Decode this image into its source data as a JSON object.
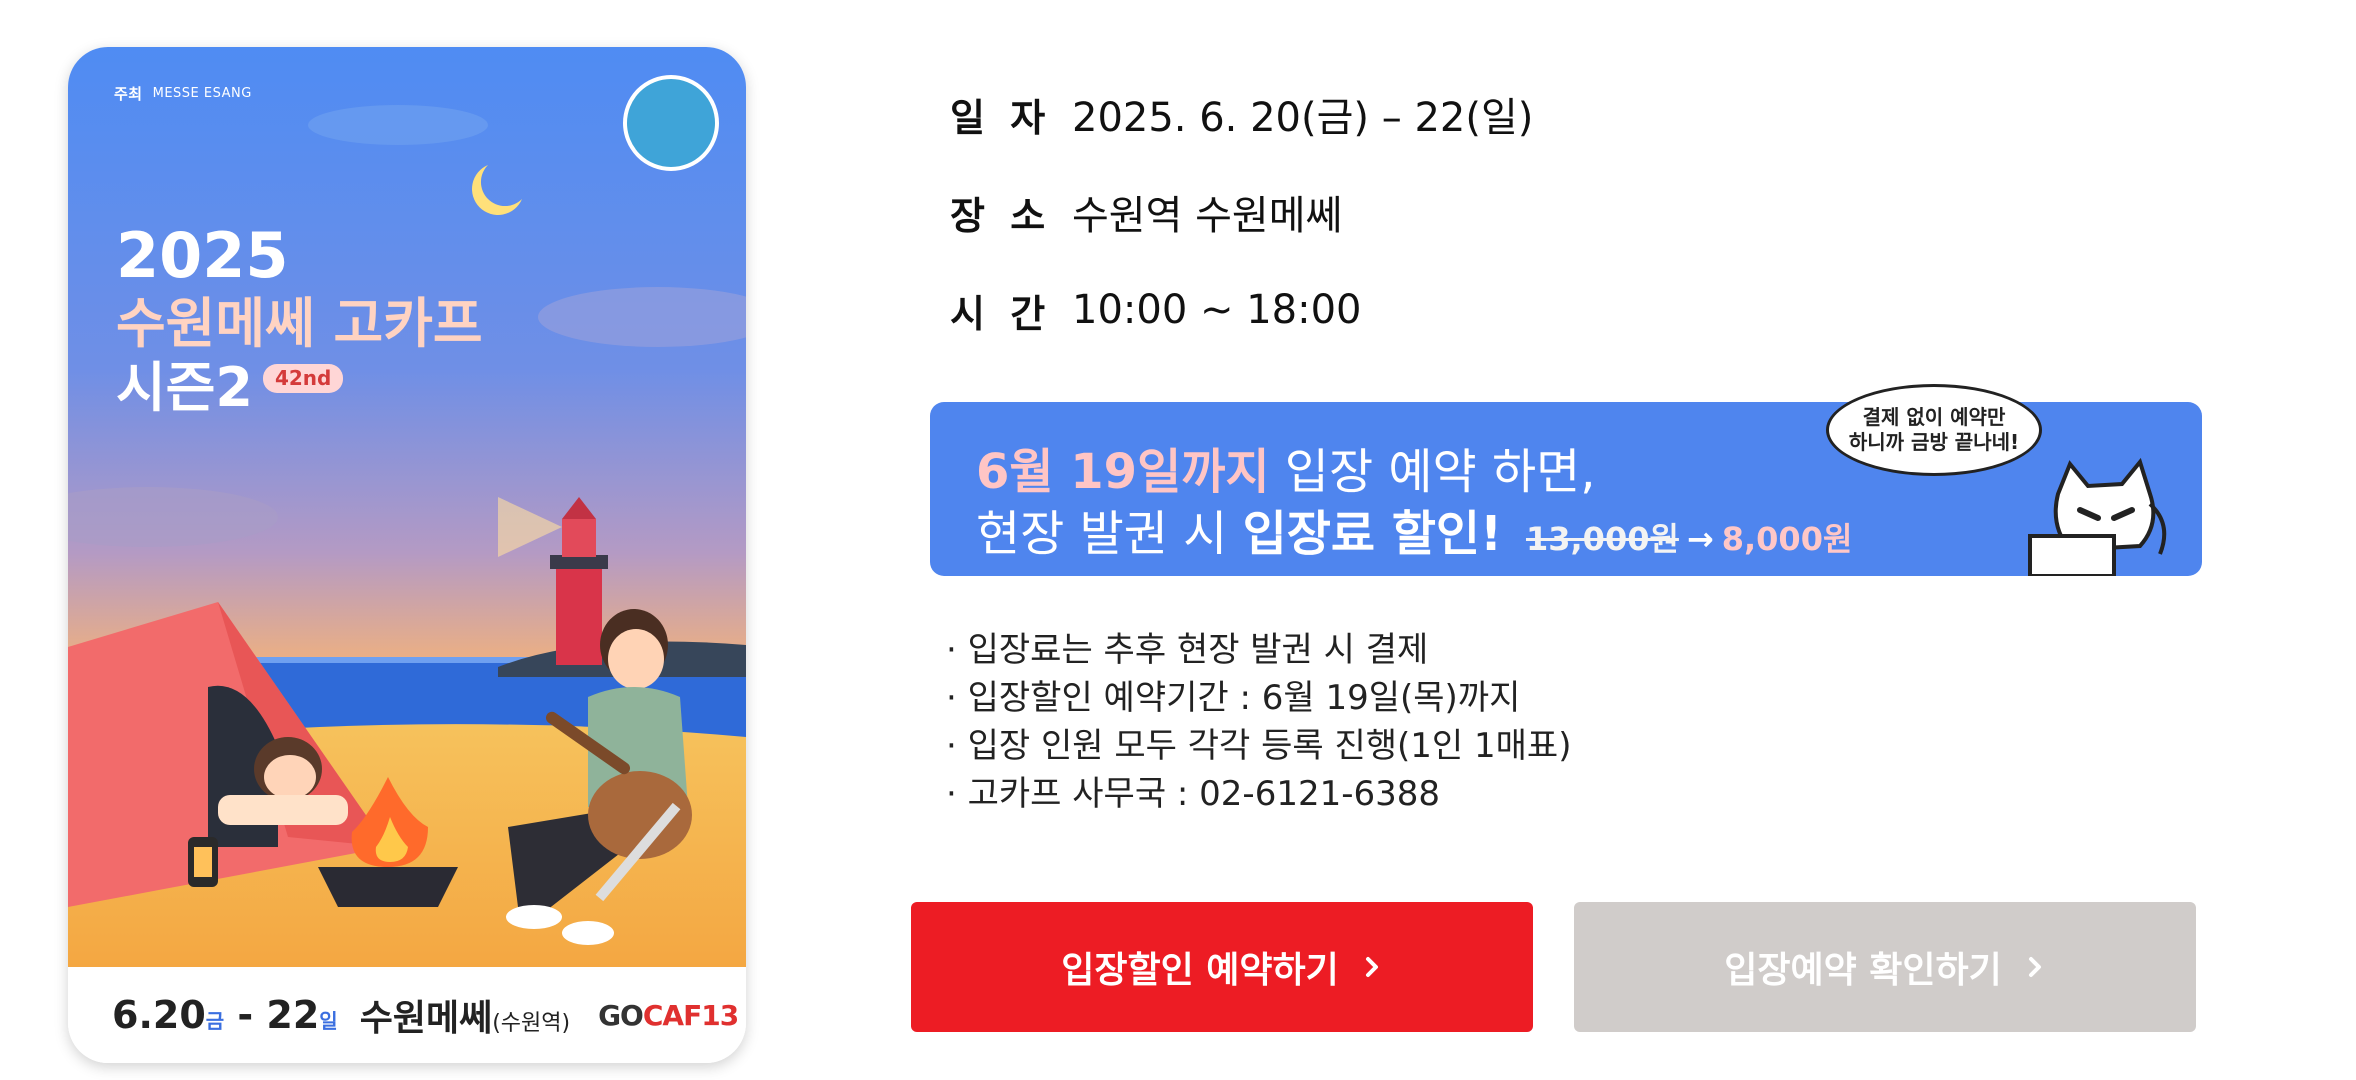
{
  "poster": {
    "host_label": "주최",
    "host_brand": "MESSE ESANG",
    "year": "2025",
    "name": "수원메쎄 고카프",
    "season": "시즌2",
    "ordinal": "42nd",
    "dates": "6.20",
    "dates_dow_start": "금",
    "dates_end": " - 22",
    "dates_dow_end": "일",
    "venue": "수원메쎄",
    "venue_sub": "(수원역)",
    "logo_a": "GO",
    "logo_b": "CAF13"
  },
  "info": {
    "date_label": "일 자",
    "date_value": "2025. 6. 20(금) – 22(일)",
    "place_label": "장 소",
    "place_value": "수원역 수원메쎄",
    "time_label": "시 간",
    "time_value": "10:00 ~ 18:00"
  },
  "banner": {
    "line1_highlight": "6월 19일까지",
    "line1_rest": " 입장 예약 하면,",
    "line2_start": "현장 발권 시 ",
    "line2_strong": "입장료 할인!",
    "old_price": "13,000원",
    "arrow": "→",
    "new_price": "8,000원",
    "bubble_line1": "결제 없이 예약만",
    "bubble_line2": "하니까 금방 끝나네!"
  },
  "notes": [
    "· 입장료는 추후 현장 발권 시 결제",
    "· 입장할인 예약기간 : 6월 19일(목)까지",
    "· 입장 인원 모두 각각 등록 진행(1인 1매표)",
    "· 고카프 사무국 : 02-6121-6388"
  ],
  "buttons": {
    "reserve": "입장할인 예약하기",
    "check": "입장예약 확인하기"
  },
  "colors": {
    "primary_button": "#ed1c24",
    "secondary_button": "#d0ccca",
    "banner_blue": "#4f85ee"
  }
}
